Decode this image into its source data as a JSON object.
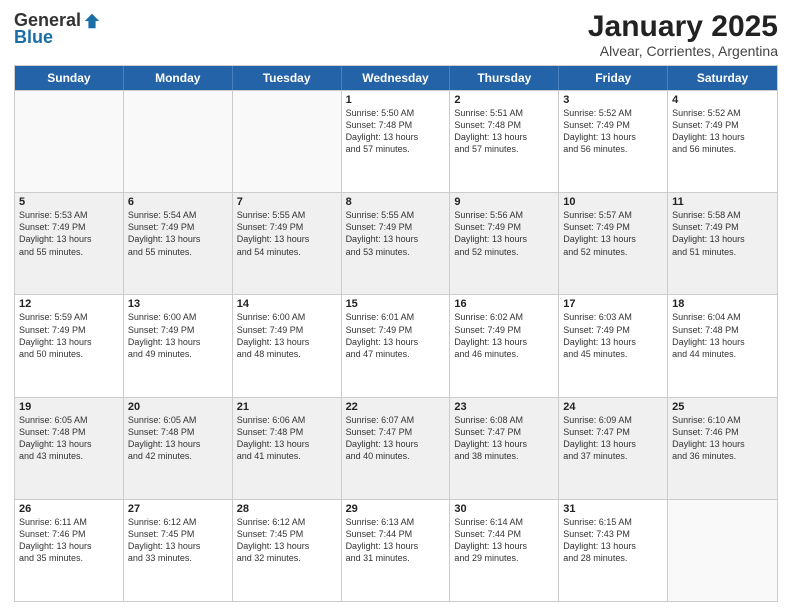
{
  "header": {
    "logo_general": "General",
    "logo_blue": "Blue",
    "title": "January 2025",
    "subtitle": "Alvear, Corrientes, Argentina"
  },
  "weekdays": [
    "Sunday",
    "Monday",
    "Tuesday",
    "Wednesday",
    "Thursday",
    "Friday",
    "Saturday"
  ],
  "rows": [
    [
      {
        "day": "",
        "info": "",
        "empty": true
      },
      {
        "day": "",
        "info": "",
        "empty": true
      },
      {
        "day": "",
        "info": "",
        "empty": true
      },
      {
        "day": "1",
        "info": "Sunrise: 5:50 AM\nSunset: 7:48 PM\nDaylight: 13 hours\nand 57 minutes.",
        "empty": false
      },
      {
        "day": "2",
        "info": "Sunrise: 5:51 AM\nSunset: 7:48 PM\nDaylight: 13 hours\nand 57 minutes.",
        "empty": false
      },
      {
        "day": "3",
        "info": "Sunrise: 5:52 AM\nSunset: 7:49 PM\nDaylight: 13 hours\nand 56 minutes.",
        "empty": false
      },
      {
        "day": "4",
        "info": "Sunrise: 5:52 AM\nSunset: 7:49 PM\nDaylight: 13 hours\nand 56 minutes.",
        "empty": false
      }
    ],
    [
      {
        "day": "5",
        "info": "Sunrise: 5:53 AM\nSunset: 7:49 PM\nDaylight: 13 hours\nand 55 minutes.",
        "empty": false
      },
      {
        "day": "6",
        "info": "Sunrise: 5:54 AM\nSunset: 7:49 PM\nDaylight: 13 hours\nand 55 minutes.",
        "empty": false
      },
      {
        "day": "7",
        "info": "Sunrise: 5:55 AM\nSunset: 7:49 PM\nDaylight: 13 hours\nand 54 minutes.",
        "empty": false
      },
      {
        "day": "8",
        "info": "Sunrise: 5:55 AM\nSunset: 7:49 PM\nDaylight: 13 hours\nand 53 minutes.",
        "empty": false
      },
      {
        "day": "9",
        "info": "Sunrise: 5:56 AM\nSunset: 7:49 PM\nDaylight: 13 hours\nand 52 minutes.",
        "empty": false
      },
      {
        "day": "10",
        "info": "Sunrise: 5:57 AM\nSunset: 7:49 PM\nDaylight: 13 hours\nand 52 minutes.",
        "empty": false
      },
      {
        "day": "11",
        "info": "Sunrise: 5:58 AM\nSunset: 7:49 PM\nDaylight: 13 hours\nand 51 minutes.",
        "empty": false
      }
    ],
    [
      {
        "day": "12",
        "info": "Sunrise: 5:59 AM\nSunset: 7:49 PM\nDaylight: 13 hours\nand 50 minutes.",
        "empty": false
      },
      {
        "day": "13",
        "info": "Sunrise: 6:00 AM\nSunset: 7:49 PM\nDaylight: 13 hours\nand 49 minutes.",
        "empty": false
      },
      {
        "day": "14",
        "info": "Sunrise: 6:00 AM\nSunset: 7:49 PM\nDaylight: 13 hours\nand 48 minutes.",
        "empty": false
      },
      {
        "day": "15",
        "info": "Sunrise: 6:01 AM\nSunset: 7:49 PM\nDaylight: 13 hours\nand 47 minutes.",
        "empty": false
      },
      {
        "day": "16",
        "info": "Sunrise: 6:02 AM\nSunset: 7:49 PM\nDaylight: 13 hours\nand 46 minutes.",
        "empty": false
      },
      {
        "day": "17",
        "info": "Sunrise: 6:03 AM\nSunset: 7:49 PM\nDaylight: 13 hours\nand 45 minutes.",
        "empty": false
      },
      {
        "day": "18",
        "info": "Sunrise: 6:04 AM\nSunset: 7:48 PM\nDaylight: 13 hours\nand 44 minutes.",
        "empty": false
      }
    ],
    [
      {
        "day": "19",
        "info": "Sunrise: 6:05 AM\nSunset: 7:48 PM\nDaylight: 13 hours\nand 43 minutes.",
        "empty": false
      },
      {
        "day": "20",
        "info": "Sunrise: 6:05 AM\nSunset: 7:48 PM\nDaylight: 13 hours\nand 42 minutes.",
        "empty": false
      },
      {
        "day": "21",
        "info": "Sunrise: 6:06 AM\nSunset: 7:48 PM\nDaylight: 13 hours\nand 41 minutes.",
        "empty": false
      },
      {
        "day": "22",
        "info": "Sunrise: 6:07 AM\nSunset: 7:47 PM\nDaylight: 13 hours\nand 40 minutes.",
        "empty": false
      },
      {
        "day": "23",
        "info": "Sunrise: 6:08 AM\nSunset: 7:47 PM\nDaylight: 13 hours\nand 38 minutes.",
        "empty": false
      },
      {
        "day": "24",
        "info": "Sunrise: 6:09 AM\nSunset: 7:47 PM\nDaylight: 13 hours\nand 37 minutes.",
        "empty": false
      },
      {
        "day": "25",
        "info": "Sunrise: 6:10 AM\nSunset: 7:46 PM\nDaylight: 13 hours\nand 36 minutes.",
        "empty": false
      }
    ],
    [
      {
        "day": "26",
        "info": "Sunrise: 6:11 AM\nSunset: 7:46 PM\nDaylight: 13 hours\nand 35 minutes.",
        "empty": false
      },
      {
        "day": "27",
        "info": "Sunrise: 6:12 AM\nSunset: 7:45 PM\nDaylight: 13 hours\nand 33 minutes.",
        "empty": false
      },
      {
        "day": "28",
        "info": "Sunrise: 6:12 AM\nSunset: 7:45 PM\nDaylight: 13 hours\nand 32 minutes.",
        "empty": false
      },
      {
        "day": "29",
        "info": "Sunrise: 6:13 AM\nSunset: 7:44 PM\nDaylight: 13 hours\nand 31 minutes.",
        "empty": false
      },
      {
        "day": "30",
        "info": "Sunrise: 6:14 AM\nSunset: 7:44 PM\nDaylight: 13 hours\nand 29 minutes.",
        "empty": false
      },
      {
        "day": "31",
        "info": "Sunrise: 6:15 AM\nSunset: 7:43 PM\nDaylight: 13 hours\nand 28 minutes.",
        "empty": false
      },
      {
        "day": "",
        "info": "",
        "empty": true
      }
    ]
  ]
}
